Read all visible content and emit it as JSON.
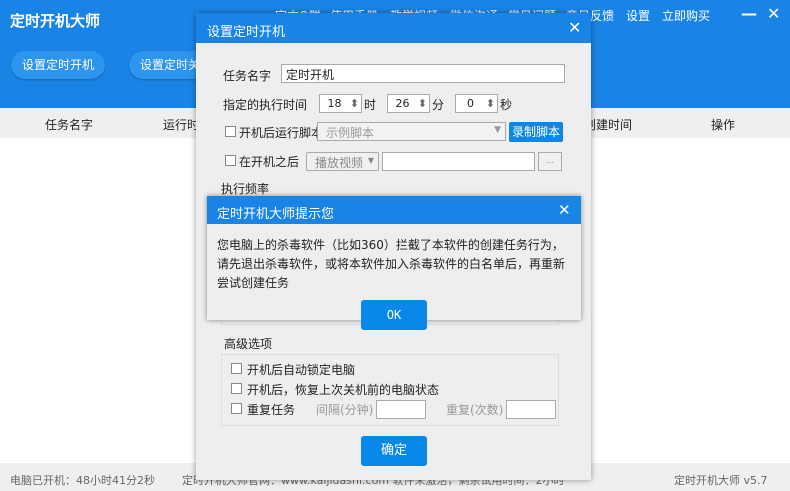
{
  "app": {
    "title": "定时开机大师",
    "minimize_icon": "minimize-icon",
    "close_icon": "close-icon"
  },
  "nav": [
    "官方Q群",
    "使用手册",
    "教学视频",
    "微信沟通",
    "常见问题",
    "意见反馈",
    "设置",
    "立即购买"
  ],
  "toolbar": {
    "set_boot": "设置定时开机",
    "set_shutdown": "设置定时关机"
  },
  "table": {
    "headers": [
      "任务名字",
      "运行时间",
      "创建时间",
      "操作"
    ]
  },
  "status": {
    "uptime": "电脑已开机：48小时41分2秒",
    "site": "定时开机大师官网：www.kaijidashi.com 软件未激活，剩余试用时间：2小时",
    "version": "定时开机大师 v5.7"
  },
  "dialog": {
    "title": "设置定时开机",
    "task_name_label": "任务名字",
    "task_name_value": "定时开机",
    "time_label": "指定的执行时间",
    "hour": "18",
    "hour_unit": "时",
    "minute": "26",
    "minute_unit": "分",
    "second": "0",
    "second_unit": "秒",
    "run_script_label": "开机后运行脚本",
    "script_select": "示例脚本",
    "record_script": "录制脚本",
    "after_boot_label": "在开机之后",
    "after_boot_select": "播放视频",
    "after_boot_value": "",
    "browse": "...",
    "frequency_label": "执行频率",
    "advanced_label": "高级选项",
    "lock_pc": "开机后自动锁定电脑",
    "restore_state": "开机后，恢复上次关机前的电脑状态",
    "repeat_task": "重复任务",
    "interval_label": "间隔(分钟)",
    "interval_value": "",
    "repeat_count_label": "重复(次数)",
    "repeat_count_value": "",
    "confirm": "确定"
  },
  "alert": {
    "title": "定时开机大师提示您",
    "message": "您电脑上的杀毒软件（比如360）拦截了本软件的创建任务行为，请先退出杀毒软件，或将本软件加入杀毒软件的白名单后，再重新尝试创建任务",
    "ok": "OK"
  },
  "colors": {
    "accent": "#1a84e6",
    "button": "#0a88ea"
  }
}
